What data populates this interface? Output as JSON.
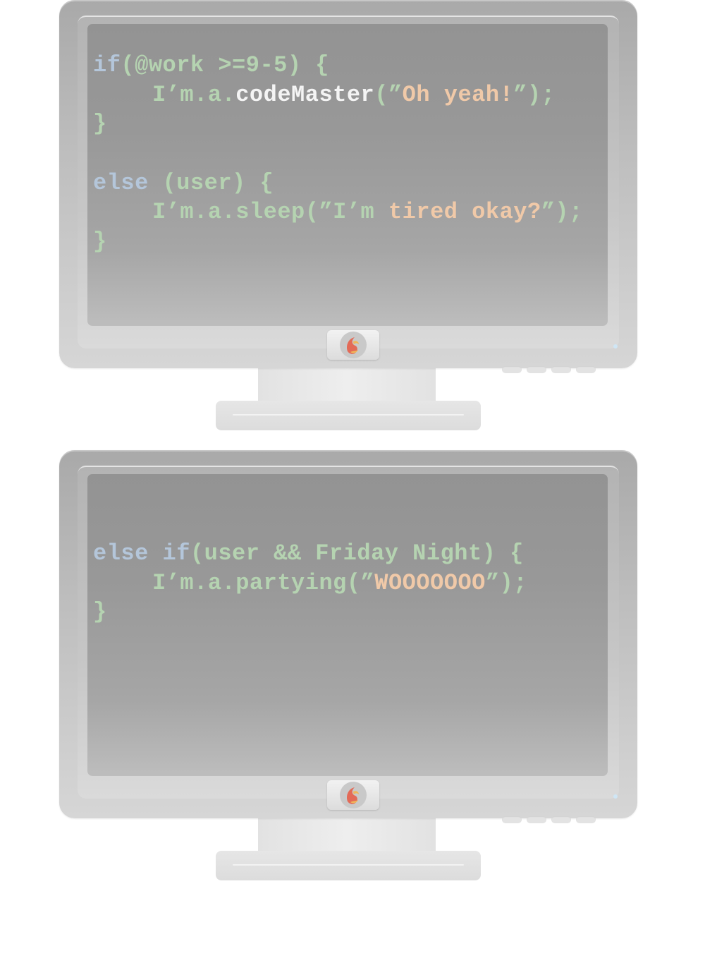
{
  "colors": {
    "keyword": "#b4c6da",
    "text": "#b5d3b1",
    "string": "#f0c9a8",
    "method": "#f4f4f4",
    "logo_red": "#e36a57",
    "logo_yellow": "#f0b75a"
  },
  "monitors": [
    {
      "icons": [
        "logo-icon",
        "power-led-icon"
      ],
      "lines": [
        {
          "indent": false,
          "tokens": [
            {
              "t": "if",
              "c": "keyword"
            },
            {
              "t": "(@work >=9-5) {",
              "c": "text"
            }
          ]
        },
        {
          "indent": true,
          "tokens": [
            {
              "t": "I’m.a.",
              "c": "text"
            },
            {
              "t": "codeMaster",
              "c": "method"
            },
            {
              "t": "(”",
              "c": "text"
            },
            {
              "t": "Oh yeah!",
              "c": "string"
            },
            {
              "t": "”);",
              "c": "text"
            }
          ]
        },
        {
          "indent": false,
          "tokens": [
            {
              "t": "}",
              "c": "text"
            }
          ]
        },
        {
          "indent": false,
          "tokens": []
        },
        {
          "indent": false,
          "tokens": [
            {
              "t": "else",
              "c": "keyword"
            },
            {
              "t": " (user) {",
              "c": "text"
            }
          ]
        },
        {
          "indent": true,
          "tokens": [
            {
              "t": "I’m.a.sleep(”I’m ",
              "c": "text"
            },
            {
              "t": "tired okay?",
              "c": "string"
            },
            {
              "t": "”);",
              "c": "text"
            }
          ]
        },
        {
          "indent": false,
          "tokens": [
            {
              "t": "}",
              "c": "text"
            }
          ]
        }
      ]
    },
    {
      "icons": [
        "logo-icon",
        "power-led-icon"
      ],
      "lines": [
        {
          "indent": false,
          "tokens": [
            {
              "t": "else if",
              "c": "keyword"
            },
            {
              "t": "(user && Friday Night) {",
              "c": "text"
            }
          ]
        },
        {
          "indent": true,
          "tokens": [
            {
              "t": "I’m.a.partying(”",
              "c": "text"
            },
            {
              "t": "WOOOOOOO",
              "c": "string"
            },
            {
              "t": "”);",
              "c": "text"
            }
          ]
        },
        {
          "indent": false,
          "tokens": [
            {
              "t": "}",
              "c": "text"
            }
          ]
        }
      ]
    }
  ]
}
